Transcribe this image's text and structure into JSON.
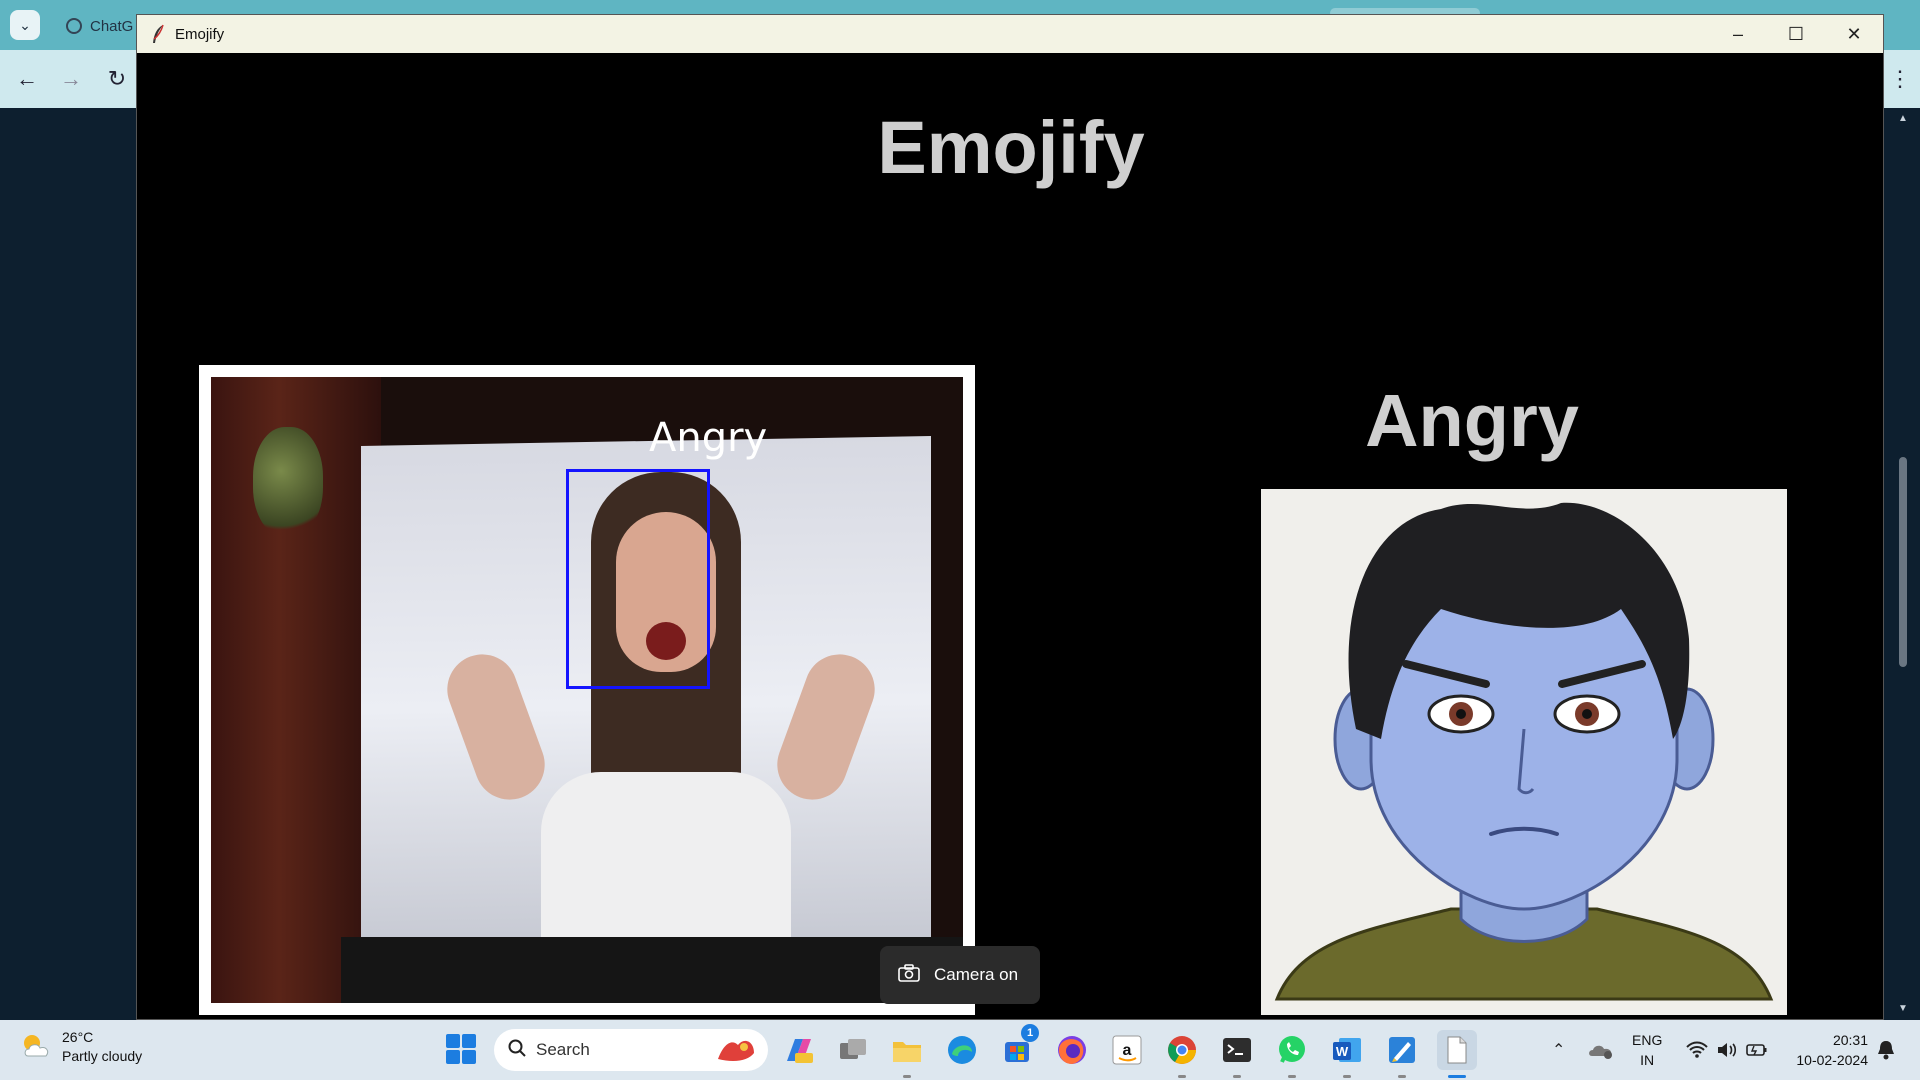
{
  "browser": {
    "tab_title": "ChatG",
    "nav": {
      "back_icon": "arrow-left-icon",
      "forward_icon": "arrow-right-icon",
      "reload_icon": "reload-icon"
    }
  },
  "window": {
    "title": "Emojify",
    "controls": [
      "minimize",
      "maximize",
      "close"
    ]
  },
  "app": {
    "heading": "Emojify",
    "video_label": "Angry",
    "emotion_result": "Angry"
  },
  "toast": {
    "text": "Camera on",
    "icon": "camera-icon"
  },
  "taskbar": {
    "weather": {
      "temp": "26°C",
      "condition": "Partly cloudy"
    },
    "search_placeholder": "Search",
    "store_badge": "1",
    "language": {
      "line1": "ENG",
      "line2": "IN"
    },
    "clock": {
      "time": "20:31",
      "date": "10-02-2024"
    }
  }
}
